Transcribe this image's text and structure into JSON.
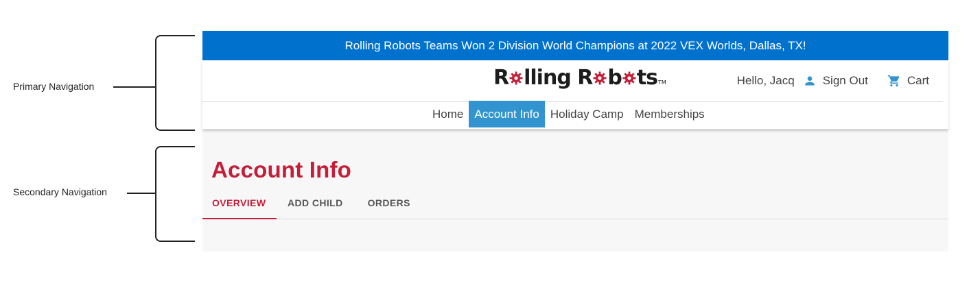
{
  "annotations": {
    "primary_label": "Primary Navigation",
    "secondary_label": "Secondary Navigation"
  },
  "banner": {
    "text": "Rolling Robots Teams Won 2 Division World Champions at 2022 VEX Worlds, Dallas, TX!",
    "color": "#0072ce"
  },
  "header": {
    "logo": {
      "part1": "R",
      "part2": "lling R",
      "part3": "b",
      "part4": "ts",
      "tm": "TM"
    },
    "greeting": "Hello, Jacq",
    "sign_out": "Sign Out",
    "cart": "Cart",
    "icons": {
      "user": "person-icon",
      "cart": "cart-icon"
    }
  },
  "menu": {
    "items": [
      {
        "label": "Home"
      },
      {
        "label": "Account Info",
        "active": true
      },
      {
        "label": "Holiday Camp"
      },
      {
        "label": "Memberships"
      }
    ],
    "active_color": "#3194ce"
  },
  "page": {
    "title": "Account Info",
    "accent_color": "#c31f3a",
    "tabs": [
      {
        "label": "OVERVIEW",
        "active": true
      },
      {
        "label": "ADD CHILD"
      },
      {
        "label": "ORDERS"
      }
    ]
  }
}
